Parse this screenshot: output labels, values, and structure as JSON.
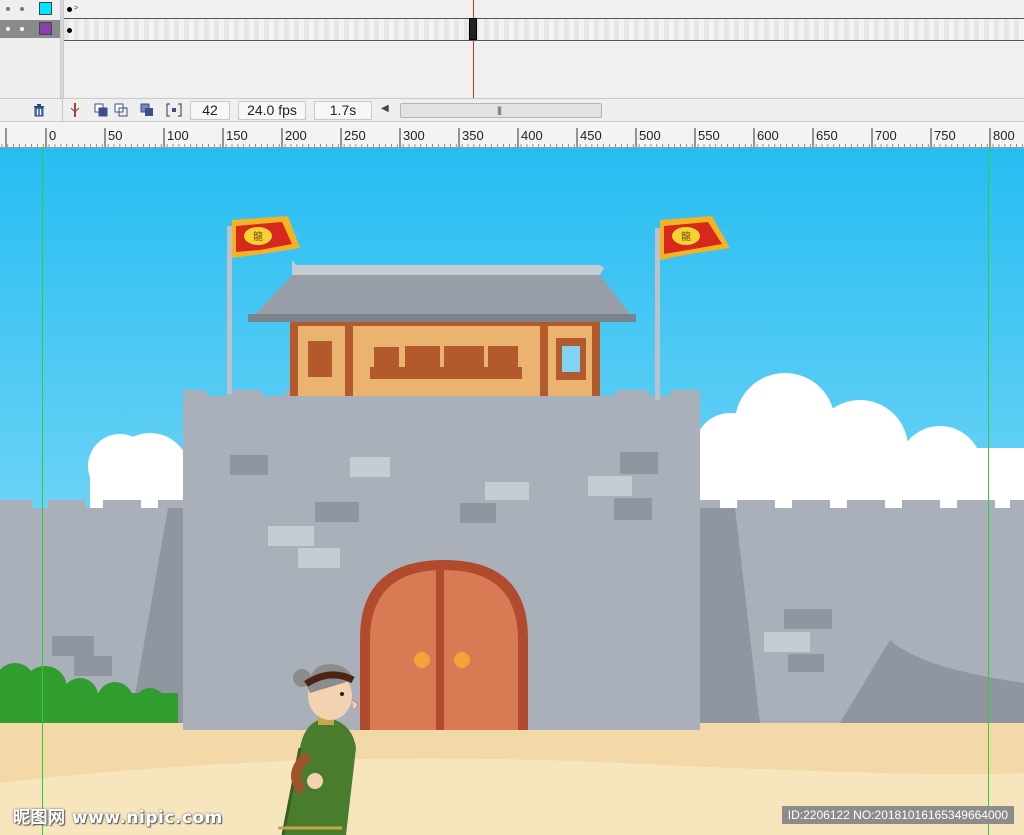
{
  "timeline": {
    "layers": [
      {
        "color": "#00e5ff",
        "selected": false
      },
      {
        "color": "#8a3fb0",
        "selected": true
      }
    ],
    "current_frame": "42",
    "fps": "24.0 fps",
    "elapsed": "1.7s"
  },
  "ruler": {
    "labels": [
      "0",
      "50",
      "100",
      "150",
      "200",
      "250",
      "300",
      "350",
      "400",
      "450",
      "500",
      "550",
      "600",
      "650",
      "700",
      "750",
      "800"
    ]
  },
  "stage": {
    "sky_color": "#3ec4f5",
    "wall_color": "#a9b0b9",
    "door_color": "#d87a53",
    "ground_color": "#f3d9a8"
  },
  "watermark": {
    "left": "昵图网 www.nipic.com",
    "right": "ID:2206122 NO:20181016165349664000"
  }
}
